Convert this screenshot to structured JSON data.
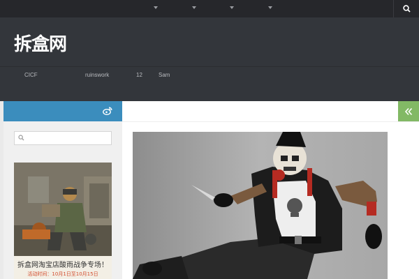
{
  "logo": {
    "text": "拆盒网"
  },
  "nav": {
    "items": [
      "CICF",
      "ruinswork",
      "12",
      "Sam"
    ]
  },
  "search": {
    "placeholder": ""
  },
  "ad": {
    "title": "拆盒网淘宝店酸雨战争专场！",
    "subtitle": "活动时间：10月1日至10月15日"
  },
  "icons": {
    "search": "search-icon",
    "weibo": "weibo-icon",
    "toggle": "double-chevron-left-icon"
  },
  "colors": {
    "topbar": "#26272b",
    "header": "#33363b",
    "sidebar_accent": "#3b8dbd",
    "toggle_accent": "#82b965"
  }
}
